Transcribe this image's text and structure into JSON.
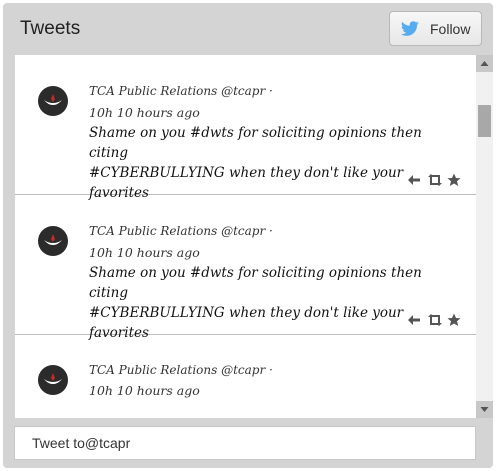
{
  "header": {
    "title": "Tweets",
    "follow_label": "Follow"
  },
  "tweets": [
    {
      "author": "TCA Public Relations @tcapr",
      "separator": "·",
      "time": "10h 10 hours ago",
      "text_line1": "Shame on you #dwts for soliciting opinions then citing",
      "text_line2": "#CYBERBULLYING when they don't like your favorites"
    },
    {
      "author": "TCA Public Relations @tcapr",
      "separator": "·",
      "time": "10h 10 hours ago",
      "text_line1": "Shame on you #dwts for soliciting opinions then citing",
      "text_line2": "#CYBERBULLYING when they don't like your favorites"
    },
    {
      "author": "TCA Public Relations @tcapr",
      "separator": "·",
      "time": "10h 10 hours ago"
    }
  ],
  "icons": {
    "follow": "twitter-bird-icon",
    "reply": "reply-arrow-icon",
    "retweet": "retweet-icon",
    "favorite": "star-icon"
  },
  "colors": {
    "frame": "#d4d4d4",
    "twitter_blue": "#55acee",
    "avatar_accent": "#c62828"
  },
  "compose": {
    "label": "Tweet to@tcapr"
  }
}
